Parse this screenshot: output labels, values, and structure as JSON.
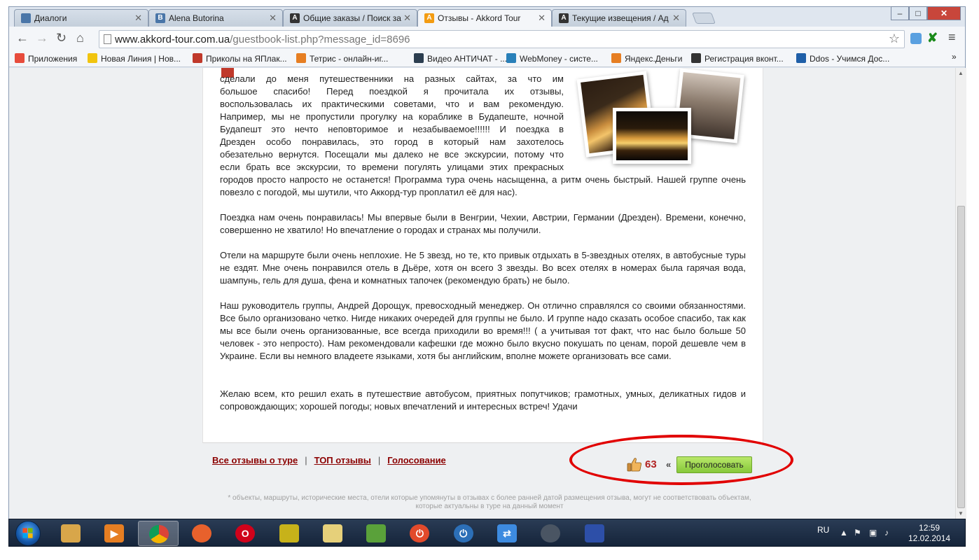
{
  "tabs": [
    {
      "title": "Диалоги",
      "icon": "vk-icon",
      "color": "#4a76a8",
      "glyph": "",
      "active": false
    },
    {
      "title": "Alena Butorina",
      "icon": "vk-icon",
      "color": "#4a76a8",
      "glyph": "В",
      "active": false
    },
    {
      "title": "Общие заказы / Поиск за",
      "icon": "advego-icon",
      "color": "#333333",
      "glyph": "A",
      "active": false
    },
    {
      "title": "Отзывы - Akkord Tour",
      "icon": "akkord-icon",
      "color": "#f39c12",
      "glyph": "A",
      "active": true
    },
    {
      "title": "Текущие извещения / Ад",
      "icon": "advego-icon",
      "color": "#333333",
      "glyph": "A",
      "active": false
    }
  ],
  "toolbar": {
    "url_host": "www.akkord-tour.com.ua",
    "url_path": "/guestbook-list.php?message_id=8696"
  },
  "bookmarks": [
    {
      "label": "Приложения",
      "icon": "apps-grid-icon",
      "color": "#e74c3c"
    },
    {
      "label": "Новая Линия | Нов...",
      "icon": "novaya-liniya-icon",
      "color": "#f1c40f"
    },
    {
      "label": "Приколы на ЯПлак...",
      "icon": "yaplakal-icon",
      "color": "#c0392b"
    },
    {
      "label": "Тетрис - онлайн-иг...",
      "icon": "tetris-icon",
      "color": "#e67e22"
    },
    {
      "label": "Видео АНТИЧАТ - ...",
      "icon": "antichat-icon",
      "color": "#2c3e50"
    },
    {
      "label": "WebMoney - систе...",
      "icon": "webmoney-icon",
      "color": "#2980b9"
    },
    {
      "label": "Яндекс.Деньги",
      "icon": "yandex-money-icon",
      "color": "#e67e22"
    },
    {
      "label": "Регистрация вконт...",
      "icon": "advego-icon",
      "color": "#333333"
    },
    {
      "label": "Ddos - Учимся Дос...",
      "icon": "bit-icon",
      "color": "#1f5fa8"
    }
  ],
  "review": {
    "intro_lines": [
      "сделали до меня путешественники на разных сайтах, за что им",
      "большое спасибо! Перед поездкой я прочитала их отзывы,",
      "воспользовалась их практическими советами, что и вам рекомендую.",
      "Например, мы не пропустили прогулку на кораблике в Будапеште, ночной",
      "Будапешт это нечто неповторимое и незабываемое!!!!!! И поездка в",
      "Дрезден особо понравилась, это город в который нам захотелось",
      "обезательно вернутся. Посещали мы далеко не все экскурсии, потому что",
      "если брать все экскурсии, то времени погулять улицами этих прекрасных"
    ],
    "intro_full": "городов просто напросто не останется! Программа тура очень насыщенна, а ритм очень быстрый. Нашей группе очень повезло с погодой, мы шутили, что Аккорд-тур проплатил её для нас).",
    "p2": "Поездка нам очень понравилась! Мы впервые были в Венгрии, Чехии, Австрии, Германии (Дрезден). Времени, конечно, совершенно не хватило! Но впечатление о городах и странах мы получили.",
    "p3": "Отели на маршруте были очень неплохие. Не 5 звезд, но те, кто привык отдыхать в 5-звездных отелях, в автобусные туры не ездят. Мне очень понравился отель в Дьёре, хотя он всего 3 звезды. Во всех отелях в номерах была гарячая вода, шампунь, гель для душа, фена и комнатных тапочек (рекомендую брать) не было.",
    "p4": "Наш руководитель группы, Андрей Дорощук, превосходный менеджер. Он отлично справлялся со своими обязанностями. Все было организовано четко. Нигде никаких очередей для группы не было. И группе надо сказать особое спасибо, так как мы все были очень организованные, все всегда приходили во время!!! ( а учитывая тот факт, что нас было больше 50 человек - это непросто). Нам рекомендовали кафешки где можно было вкусно покушать по ценам, порой дешевле чем в Украине. Если вы немного владеете языками, хотя бы английским, вполне можете организовать все сами.",
    "p5": "Желаю всем, кто решил ехать в путешествие автобусом, приятных попутчиков; грамотных, умных, деликатных гидов и сопровождающих; хорошей погоды; новых впечатлений и интересных встреч! Удачи"
  },
  "links": {
    "all_reviews": "Все отзывы о туре",
    "top_reviews": "ТОП отзывы",
    "voting": "Голосование",
    "separator": "|"
  },
  "vote": {
    "count": "63",
    "raquo": "«",
    "button": "Проголосовать"
  },
  "footnote": "* объекты, маршруты, исторические места, отели которые упомянуты в отзывах с более ранней датой размещения отзыва, могут не соответствовать объектам, которые актуальны в туре на данный момент",
  "taskbar": {
    "apps": [
      {
        "name": "explorer-icon",
        "color": "#d8a64a",
        "glyph": "",
        "active": false
      },
      {
        "name": "media-player-icon",
        "color": "#e67e22",
        "glyph": "▶",
        "active": false
      },
      {
        "name": "chrome-icon",
        "color": "#2ecc71",
        "glyph": "",
        "active": true
      },
      {
        "name": "firefox-icon",
        "color": "#e8612c",
        "glyph": "",
        "active": false
      },
      {
        "name": "opera-icon",
        "color": "#d0021b",
        "glyph": "O",
        "active": false
      },
      {
        "name": "hamster-icon",
        "color": "#c7b21a",
        "glyph": "",
        "active": false
      },
      {
        "name": "presentation-icon",
        "color": "#e6d07a",
        "glyph": "",
        "active": false
      },
      {
        "name": "notepad-plus-icon",
        "color": "#5aa13a",
        "glyph": "",
        "active": false
      },
      {
        "name": "power-icon",
        "color": "#e24a2b",
        "glyph": "⏻",
        "active": false
      },
      {
        "name": "shutdown-timer-icon",
        "color": "#2c6fb7",
        "glyph": "⏻",
        "active": false
      },
      {
        "name": "sync-icon",
        "color": "#3d8be0",
        "glyph": "⇄",
        "active": false
      },
      {
        "name": "steam-icon",
        "color": "#4a5563",
        "glyph": "",
        "active": false
      },
      {
        "name": "floppy-save-icon",
        "color": "#2d4fa8",
        "glyph": "",
        "active": false
      }
    ],
    "lang": "RU",
    "time": "12:59",
    "date": "12.02.2014"
  }
}
